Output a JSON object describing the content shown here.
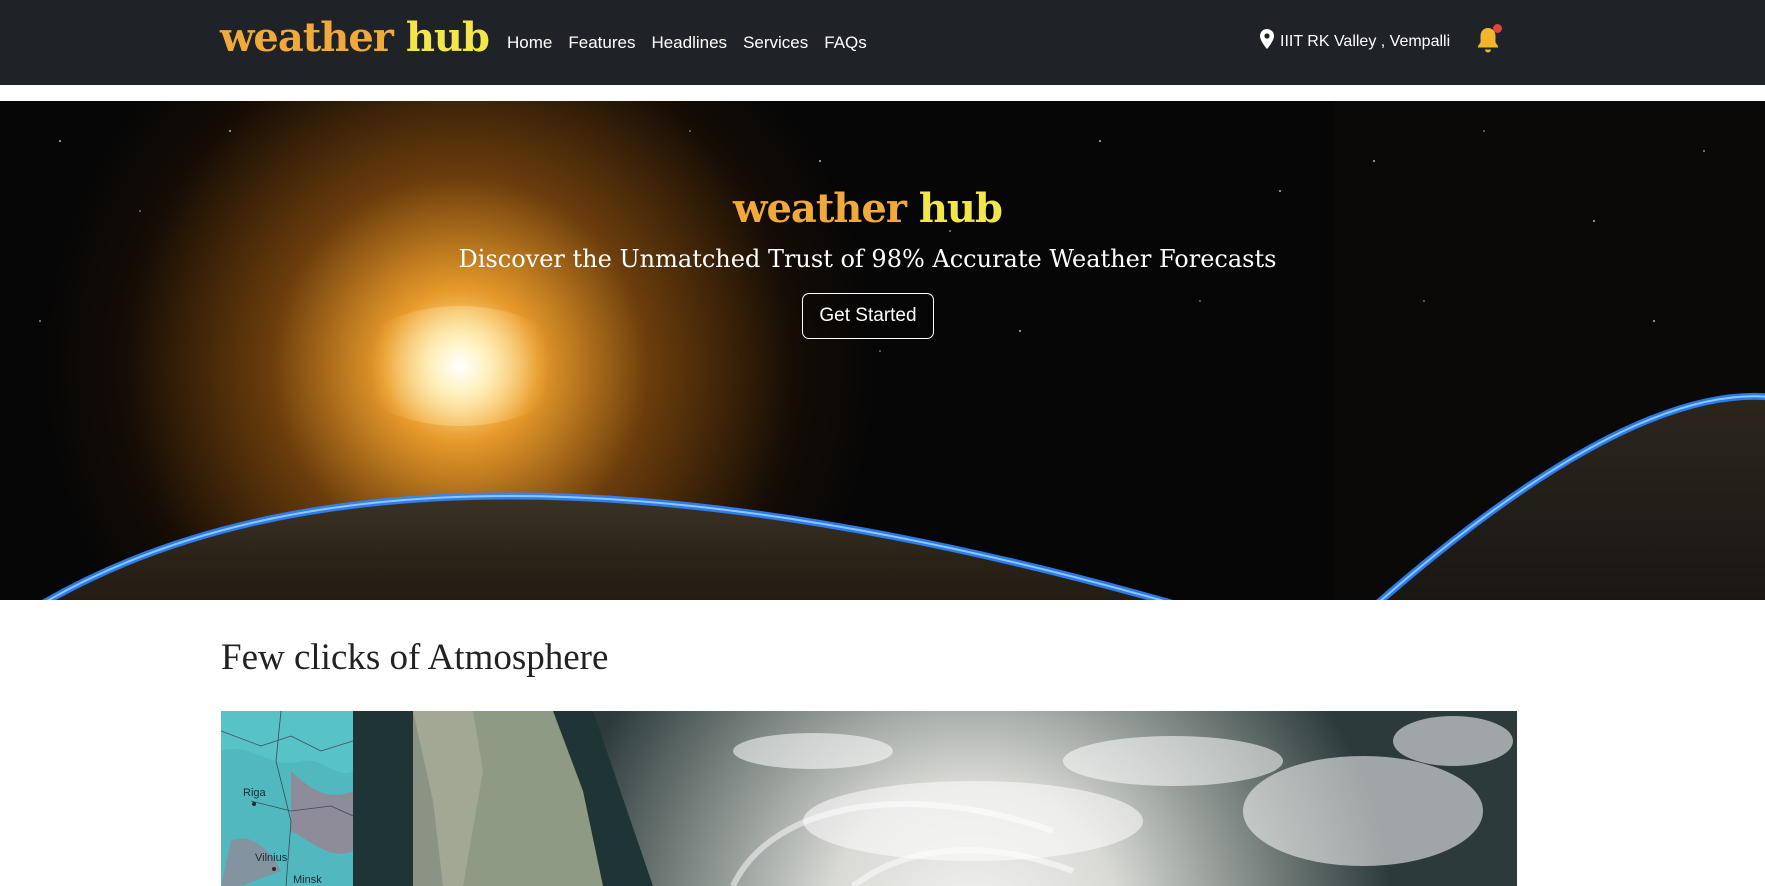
{
  "colors": {
    "brand_a": "#f2a93b",
    "brand_b": "#f3e64a",
    "navbar_bg": "#1f2227",
    "bell": "#f2b52c",
    "bell_dot": "#e0453a"
  },
  "brand": {
    "part1": "weather",
    "part2": "hub"
  },
  "nav": {
    "items": [
      "Home",
      "Features",
      "Headlines",
      "Services",
      "FAQs"
    ]
  },
  "location": {
    "icon": "map-pin-icon",
    "text": "IIIT RK Valley , Vempalli"
  },
  "notifications": {
    "icon": "bell-icon",
    "has_unread": true
  },
  "hero": {
    "title_part1": "weather",
    "title_part2": "hub",
    "subtitle": "Discover the Unmatched Trust of 98% Accurate Weather Forecasts",
    "cta_label": "Get Started"
  },
  "atmosphere": {
    "heading": "Few clicks of Atmosphere",
    "map_labels": [
      "Riga",
      "Vilnius",
      "Minsk"
    ]
  }
}
